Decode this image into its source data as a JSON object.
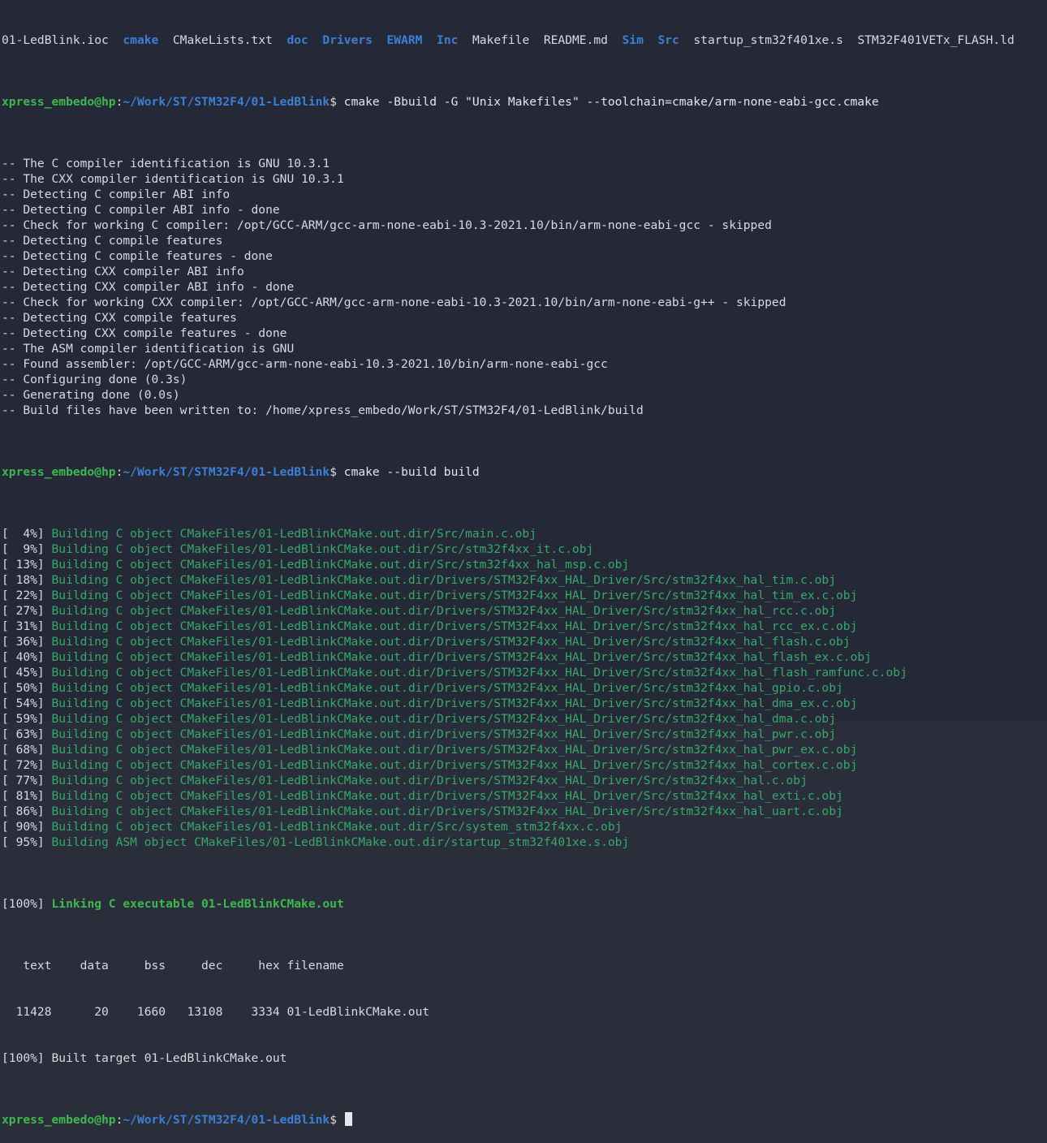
{
  "colors": {
    "background": "#252836",
    "directory": "#3c7fd4",
    "prompt_user": "#3fb84f",
    "build_text": "#38a86b",
    "default_text": "#d8dae3"
  },
  "listing": [
    {
      "name": "01-LedBlink.ioc",
      "type": "file"
    },
    {
      "name": "cmake",
      "type": "dir"
    },
    {
      "name": "CMakeLists.txt",
      "type": "file"
    },
    {
      "name": "doc",
      "type": "dir"
    },
    {
      "name": "Drivers",
      "type": "dir"
    },
    {
      "name": "EWARM",
      "type": "dir"
    },
    {
      "name": "Inc",
      "type": "dir"
    },
    {
      "name": "Makefile",
      "type": "file"
    },
    {
      "name": "README.md",
      "type": "file"
    },
    {
      "name": "Sim",
      "type": "dir"
    },
    {
      "name": "Src",
      "type": "dir"
    },
    {
      "name": "startup_stm32f401xe.s",
      "type": "file"
    },
    {
      "name": "STM32F401VETx_FLASH.ld",
      "type": "file"
    }
  ],
  "prompt": {
    "user_host": "xpress_embedo@hp",
    "separator": ":",
    "path": "~/Work/ST/STM32F4/01-LedBlink",
    "symbol": "$ "
  },
  "commands": {
    "configure": "cmake -Bbuild -G \"Unix Makefiles\" --toolchain=cmake/arm-none-eabi-gcc.cmake",
    "build": "cmake --build build"
  },
  "configure_output": [
    "-- The C compiler identification is GNU 10.3.1",
    "-- The CXX compiler identification is GNU 10.3.1",
    "-- Detecting C compiler ABI info",
    "-- Detecting C compiler ABI info - done",
    "-- Check for working C compiler: /opt/GCC-ARM/gcc-arm-none-eabi-10.3-2021.10/bin/arm-none-eabi-gcc - skipped",
    "-- Detecting C compile features",
    "-- Detecting C compile features - done",
    "-- Detecting CXX compiler ABI info",
    "-- Detecting CXX compiler ABI info - done",
    "-- Check for working CXX compiler: /opt/GCC-ARM/gcc-arm-none-eabi-10.3-2021.10/bin/arm-none-eabi-g++ - skipped",
    "-- Detecting CXX compile features",
    "-- Detecting CXX compile features - done",
    "-- The ASM compiler identification is GNU",
    "-- Found assembler: /opt/GCC-ARM/gcc-arm-none-eabi-10.3-2021.10/bin/arm-none-eabi-gcc",
    "-- Configuring done (0.3s)",
    "-- Generating done (0.0s)",
    "-- Build files have been written to: /home/xpress_embedo/Work/ST/STM32F4/01-LedBlink/build"
  ],
  "build_output": [
    {
      "pct": "[  4%]",
      "text": "Building C object CMakeFiles/01-LedBlinkCMake.out.dir/Src/main.c.obj"
    },
    {
      "pct": "[  9%]",
      "text": "Building C object CMakeFiles/01-LedBlinkCMake.out.dir/Src/stm32f4xx_it.c.obj"
    },
    {
      "pct": "[ 13%]",
      "text": "Building C object CMakeFiles/01-LedBlinkCMake.out.dir/Src/stm32f4xx_hal_msp.c.obj"
    },
    {
      "pct": "[ 18%]",
      "text": "Building C object CMakeFiles/01-LedBlinkCMake.out.dir/Drivers/STM32F4xx_HAL_Driver/Src/stm32f4xx_hal_tim.c.obj"
    },
    {
      "pct": "[ 22%]",
      "text": "Building C object CMakeFiles/01-LedBlinkCMake.out.dir/Drivers/STM32F4xx_HAL_Driver/Src/stm32f4xx_hal_tim_ex.c.obj"
    },
    {
      "pct": "[ 27%]",
      "text": "Building C object CMakeFiles/01-LedBlinkCMake.out.dir/Drivers/STM32F4xx_HAL_Driver/Src/stm32f4xx_hal_rcc.c.obj"
    },
    {
      "pct": "[ 31%]",
      "text": "Building C object CMakeFiles/01-LedBlinkCMake.out.dir/Drivers/STM32F4xx_HAL_Driver/Src/stm32f4xx_hal_rcc_ex.c.obj"
    },
    {
      "pct": "[ 36%]",
      "text": "Building C object CMakeFiles/01-LedBlinkCMake.out.dir/Drivers/STM32F4xx_HAL_Driver/Src/stm32f4xx_hal_flash.c.obj"
    },
    {
      "pct": "[ 40%]",
      "text": "Building C object CMakeFiles/01-LedBlinkCMake.out.dir/Drivers/STM32F4xx_HAL_Driver/Src/stm32f4xx_hal_flash_ex.c.obj"
    },
    {
      "pct": "[ 45%]",
      "text": "Building C object CMakeFiles/01-LedBlinkCMake.out.dir/Drivers/STM32F4xx_HAL_Driver/Src/stm32f4xx_hal_flash_ramfunc.c.obj"
    },
    {
      "pct": "[ 50%]",
      "text": "Building C object CMakeFiles/01-LedBlinkCMake.out.dir/Drivers/STM32F4xx_HAL_Driver/Src/stm32f4xx_hal_gpio.c.obj"
    },
    {
      "pct": "[ 54%]",
      "text": "Building C object CMakeFiles/01-LedBlinkCMake.out.dir/Drivers/STM32F4xx_HAL_Driver/Src/stm32f4xx_hal_dma_ex.c.obj"
    },
    {
      "pct": "[ 59%]",
      "text": "Building C object CMakeFiles/01-LedBlinkCMake.out.dir/Drivers/STM32F4xx_HAL_Driver/Src/stm32f4xx_hal_dma.c.obj"
    },
    {
      "pct": "[ 63%]",
      "text": "Building C object CMakeFiles/01-LedBlinkCMake.out.dir/Drivers/STM32F4xx_HAL_Driver/Src/stm32f4xx_hal_pwr.c.obj"
    },
    {
      "pct": "[ 68%]",
      "text": "Building C object CMakeFiles/01-LedBlinkCMake.out.dir/Drivers/STM32F4xx_HAL_Driver/Src/stm32f4xx_hal_pwr_ex.c.obj"
    },
    {
      "pct": "[ 72%]",
      "text": "Building C object CMakeFiles/01-LedBlinkCMake.out.dir/Drivers/STM32F4xx_HAL_Driver/Src/stm32f4xx_hal_cortex.c.obj"
    },
    {
      "pct": "[ 77%]",
      "text": "Building C object CMakeFiles/01-LedBlinkCMake.out.dir/Drivers/STM32F4xx_HAL_Driver/Src/stm32f4xx_hal.c.obj"
    },
    {
      "pct": "[ 81%]",
      "text": "Building C object CMakeFiles/01-LedBlinkCMake.out.dir/Drivers/STM32F4xx_HAL_Driver/Src/stm32f4xx_hal_exti.c.obj"
    },
    {
      "pct": "[ 86%]",
      "text": "Building C object CMakeFiles/01-LedBlinkCMake.out.dir/Drivers/STM32F4xx_HAL_Driver/Src/stm32f4xx_hal_uart.c.obj"
    },
    {
      "pct": "[ 90%]",
      "text": "Building C object CMakeFiles/01-LedBlinkCMake.out.dir/Src/system_stm32f4xx.c.obj"
    },
    {
      "pct": "[ 95%]",
      "text": "Building ASM object CMakeFiles/01-LedBlinkCMake.out.dir/startup_stm32f401xe.s.obj"
    }
  ],
  "link_line": {
    "pct": "[100%]",
    "text": "Linking C executable 01-LedBlinkCMake.out"
  },
  "size_table": {
    "header": "   text    data     bss     dec     hex filename",
    "row": "  11428      20    1660   13108    3334 01-LedBlinkCMake.out"
  },
  "built_line": "[100%] Built target 01-LedBlinkCMake.out"
}
